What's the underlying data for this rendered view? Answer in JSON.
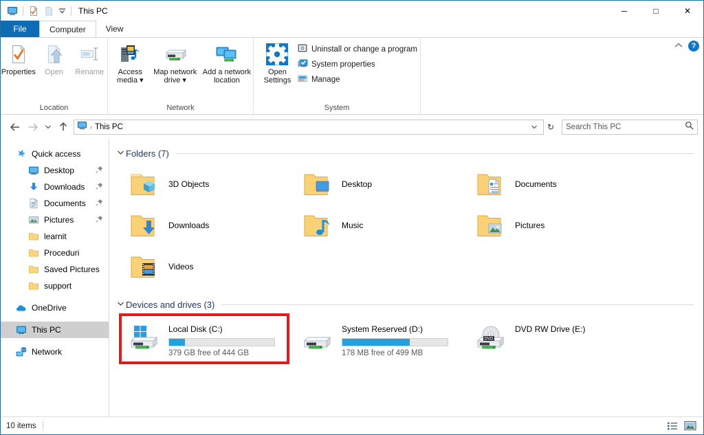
{
  "window": {
    "title": "This PC",
    "quick_access_toolbar": [
      {
        "name": "this-pc-icon",
        "label": "This PC"
      },
      {
        "name": "properties-icon",
        "label": "Properties"
      },
      {
        "name": "new-folder-icon",
        "label": "New folder"
      },
      {
        "name": "customize-icon",
        "label": "Customize Quick Access Toolbar"
      }
    ],
    "controls": {
      "minimize": "─",
      "maximize": "□",
      "close": "✕"
    }
  },
  "tabs": [
    {
      "label": "File",
      "type": "file"
    },
    {
      "label": "Computer",
      "type": "active"
    },
    {
      "label": "View",
      "type": "normal"
    }
  ],
  "ribbon": {
    "collapse_icon": "chevron-up-icon",
    "help_icon": "?",
    "groups": [
      {
        "label": "Location",
        "buttons": [
          {
            "label": "Properties",
            "icon": "properties-icon",
            "disabled": false
          },
          {
            "label": "Open",
            "icon": "open-icon",
            "disabled": true
          },
          {
            "label": "Rename",
            "icon": "rename-icon",
            "disabled": true
          }
        ]
      },
      {
        "label": "Network",
        "buttons": [
          {
            "label": "Access\nmedia ▾",
            "icon": "access-media-icon",
            "disabled": false
          },
          {
            "label": "Map network\ndrive ▾",
            "icon": "map-network-drive-icon",
            "disabled": false
          },
          {
            "label": "Add a network\nlocation",
            "icon": "add-network-location-icon",
            "disabled": false
          }
        ]
      },
      {
        "label": "System",
        "big_button": {
          "label": "Open\nSettings",
          "icon": "gear-icon"
        },
        "small_buttons": [
          {
            "label": "Uninstall or change a program",
            "icon": "uninstall-icon"
          },
          {
            "label": "System properties",
            "icon": "system-properties-icon"
          },
          {
            "label": "Manage",
            "icon": "manage-icon"
          }
        ]
      }
    ]
  },
  "address_bar": {
    "back_icon": "arrow-left-icon",
    "forward_icon": "arrow-right-icon",
    "recent_icon": "chevron-down-icon",
    "up_icon": "arrow-up-icon",
    "crumb_icon": "this-pc-icon",
    "crumb": "This PC",
    "separator": "›",
    "dropdown_icon": "chevron-down-icon",
    "refresh_icon": "↻",
    "search_placeholder": "Search This PC",
    "search_value": "",
    "search_icon": "search-icon"
  },
  "sidebar": {
    "items": [
      {
        "label": "Quick access",
        "icon": "star-pin-icon",
        "indent": 0,
        "pinned": false,
        "selected": false
      },
      {
        "label": "Desktop",
        "icon": "desktop-icon",
        "indent": 1,
        "pinned": true,
        "selected": false
      },
      {
        "label": "Downloads",
        "icon": "downloads-icon",
        "indent": 1,
        "pinned": true,
        "selected": false
      },
      {
        "label": "Documents",
        "icon": "documents-icon",
        "indent": 1,
        "pinned": true,
        "selected": false
      },
      {
        "label": "Pictures",
        "icon": "pictures-icon",
        "indent": 1,
        "pinned": true,
        "selected": false
      },
      {
        "label": "learnit",
        "icon": "folder-icon",
        "indent": 1,
        "pinned": false,
        "selected": false
      },
      {
        "label": "Proceduri",
        "icon": "folder-icon",
        "indent": 1,
        "pinned": false,
        "selected": false
      },
      {
        "label": "Saved Pictures",
        "icon": "folder-icon",
        "indent": 1,
        "pinned": false,
        "selected": false
      },
      {
        "label": "support",
        "icon": "folder-icon",
        "indent": 1,
        "pinned": false,
        "selected": false
      },
      {
        "label": "OneDrive",
        "icon": "onedrive-icon",
        "indent": 0,
        "pinned": false,
        "selected": false
      },
      {
        "label": "This PC",
        "icon": "this-pc-icon",
        "indent": 0,
        "pinned": false,
        "selected": true
      },
      {
        "label": "Network",
        "icon": "network-icon",
        "indent": 0,
        "pinned": false,
        "selected": false
      }
    ],
    "pin_glyph": "📌"
  },
  "main": {
    "folders_section": {
      "title": "Folders (7)",
      "chevron": "⌄",
      "items": [
        {
          "label": "3D Objects",
          "icon": "folder-3d-objects-icon"
        },
        {
          "label": "Desktop",
          "icon": "folder-desktop-icon"
        },
        {
          "label": "Documents",
          "icon": "folder-documents-icon"
        },
        {
          "label": "Downloads",
          "icon": "folder-downloads-icon"
        },
        {
          "label": "Music",
          "icon": "folder-music-icon"
        },
        {
          "label": "Pictures",
          "icon": "folder-pictures-icon"
        },
        {
          "label": "Videos",
          "icon": "folder-videos-icon"
        }
      ]
    },
    "drives_section": {
      "title": "Devices and drives (3)",
      "chevron": "⌄",
      "items": [
        {
          "name": "Local Disk (C:)",
          "icon": "windows-drive-icon",
          "free_text": "379 GB free of 444 GB",
          "used_percent": 15,
          "has_bar": true,
          "highlighted": true
        },
        {
          "name": "System Reserved (D:)",
          "icon": "drive-icon",
          "free_text": "178 MB free of 499 MB",
          "used_percent": 64,
          "has_bar": true,
          "highlighted": false
        },
        {
          "name": "DVD RW Drive (E:)",
          "icon": "dvd-drive-icon",
          "free_text": "",
          "used_percent": 0,
          "has_bar": false,
          "highlighted": false
        }
      ]
    }
  },
  "status_bar": {
    "item_count": "10 items",
    "view_buttons": [
      {
        "name": "details-view-button",
        "icon": "details-view-icon"
      },
      {
        "name": "large-icons-view-button",
        "icon": "large-icons-view-icon"
      }
    ]
  },
  "colors": {
    "accent_blue": "#0d6cb4",
    "progress_blue": "#26a0da",
    "highlight_red": "#e01b1b",
    "section_title": "#1f3864",
    "selection_gray": "#cfcfcf"
  }
}
